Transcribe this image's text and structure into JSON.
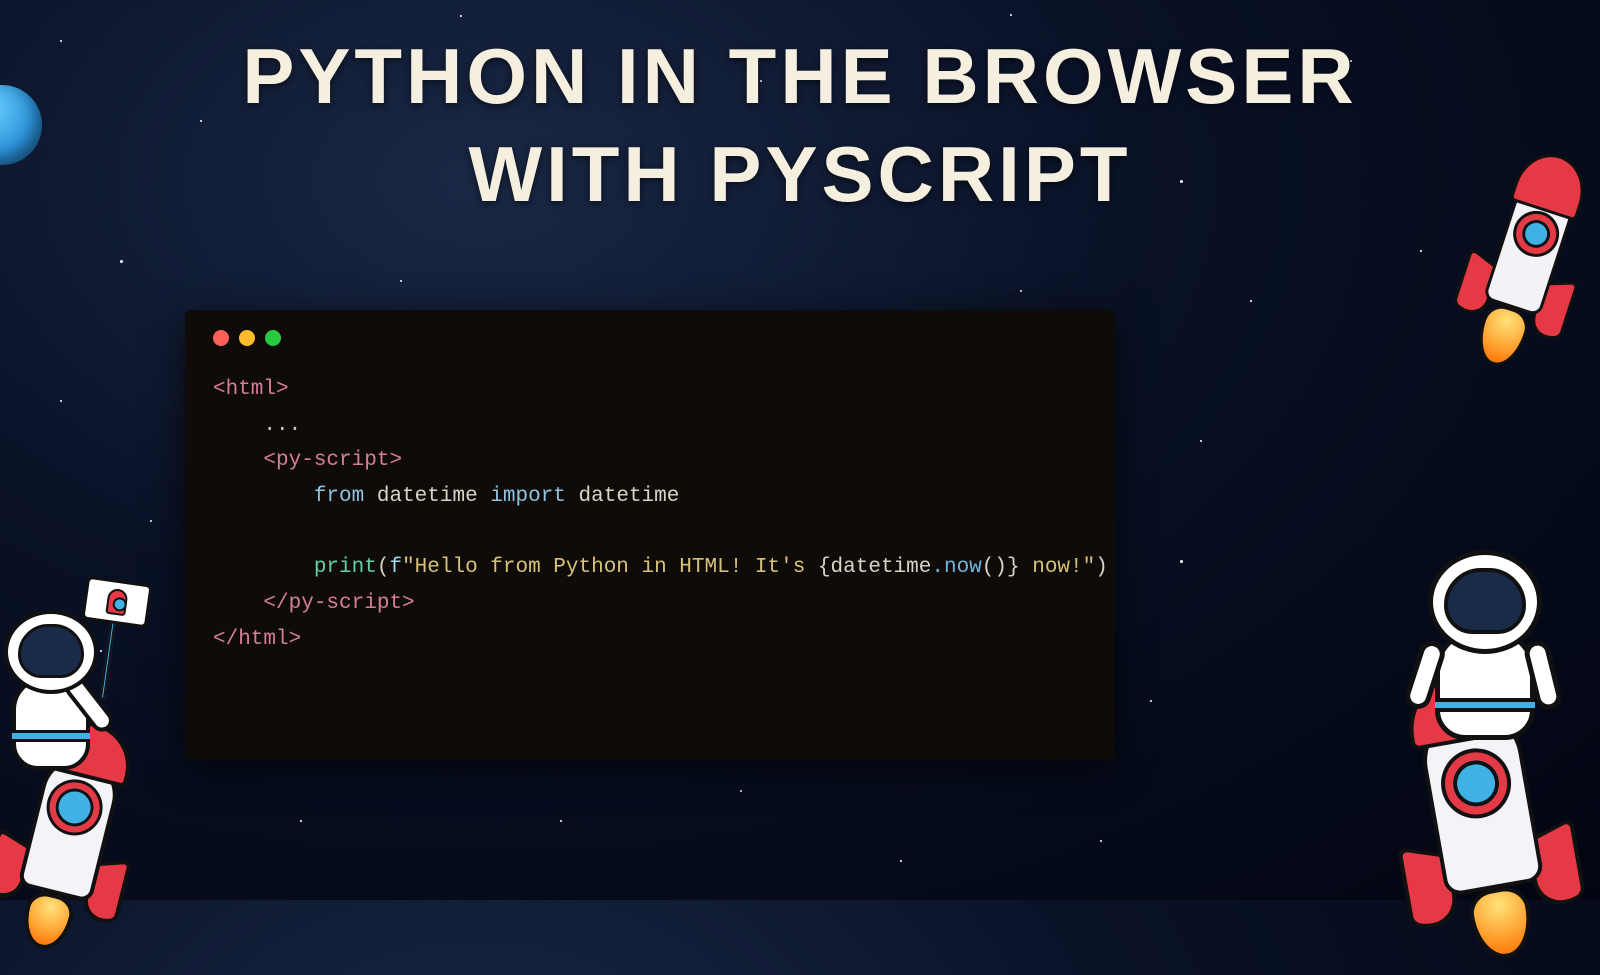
{
  "title": {
    "line1": "PYTHON IN THE BROWSER",
    "line2": "WITH PYSCRIPT"
  },
  "code_window": {
    "traffic_lights": [
      "close",
      "minimize",
      "zoom"
    ]
  },
  "code": {
    "l1_open_html": "<html>",
    "l2_ellipsis": "...",
    "l3_open_pyscript": "<py-script>",
    "l4_from": "from",
    "l4_mod1": "datetime",
    "l4_import": "import",
    "l4_mod2": "datetime",
    "l5_print": "print",
    "l5_fprefix": "f",
    "l5_str_a": "\"Hello from Python in HTML! It's ",
    "l5_expr_obj": "datetime",
    "l5_expr_dot_method": ".now",
    "l5_expr_parens": "()",
    "l5_str_b": " now!\"",
    "l6_close_pyscript": "</py-script>",
    "l7_close_html": "</html>"
  },
  "decorations": {
    "planet_left": "blue-planet",
    "rocket_top_right": "rocket-icon",
    "astronaut_bottom_left": "astronaut-with-flag-on-rocket",
    "astronaut_bottom_right": "astronaut-on-rocket"
  }
}
